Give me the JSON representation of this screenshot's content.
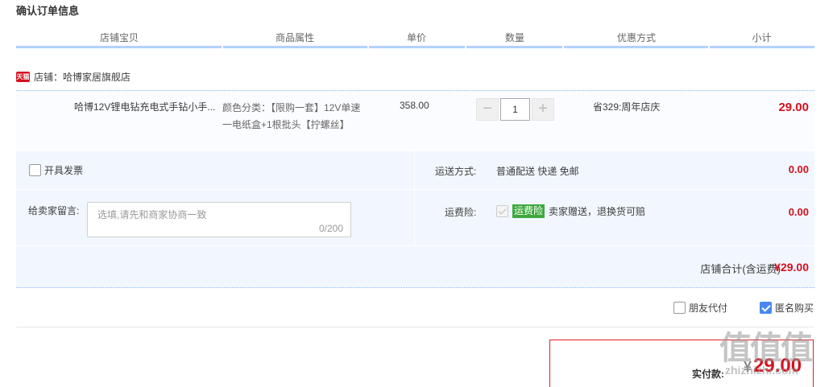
{
  "page_title": "确认订单信息",
  "table_headers": [
    "店铺宝贝",
    "商品属性",
    "单价",
    "数量",
    "优惠方式",
    "小计"
  ],
  "shop": {
    "badge": "天猫",
    "label": "店铺：哈博家居旗舰店"
  },
  "item": {
    "name": "哈博12V锂电钻充电式手钻小手...",
    "attr_line1": "颜色分类：【限购一套】12V单速",
    "attr_line2": "一电纸盒+1根批头【拧螺丝】",
    "unit_price": "358.00",
    "quantity": "1",
    "minus_label": "−",
    "plus_label": "+",
    "promotion": "省329:周年店庆",
    "subtotal": "29.00"
  },
  "invoice": {
    "label": "开具发票",
    "checked": false
  },
  "shipping": {
    "label": "运送方式:",
    "value": "普通配送 快递 免邮",
    "fee": "0.00"
  },
  "message": {
    "label": "给卖家留言:",
    "placeholder": "选填,请先和商家协商一致",
    "counter": "0/200"
  },
  "insurance": {
    "label": "运费险:",
    "tag": "运费险",
    "desc": "卖家赠送，退换货可赔",
    "fee": "0.00"
  },
  "shop_total": {
    "label": "店铺合计(含运费)",
    "value": "¥29.00"
  },
  "options": {
    "friend_pay": "朋友代付",
    "anonymous": "匿名购买",
    "anonymous_checked": true
  },
  "payment": {
    "label": "实付款:",
    "yen": "¥",
    "value": "29.00"
  },
  "watermark": {
    "logo": "值值值",
    "site": "zhizhizhi.com"
  }
}
